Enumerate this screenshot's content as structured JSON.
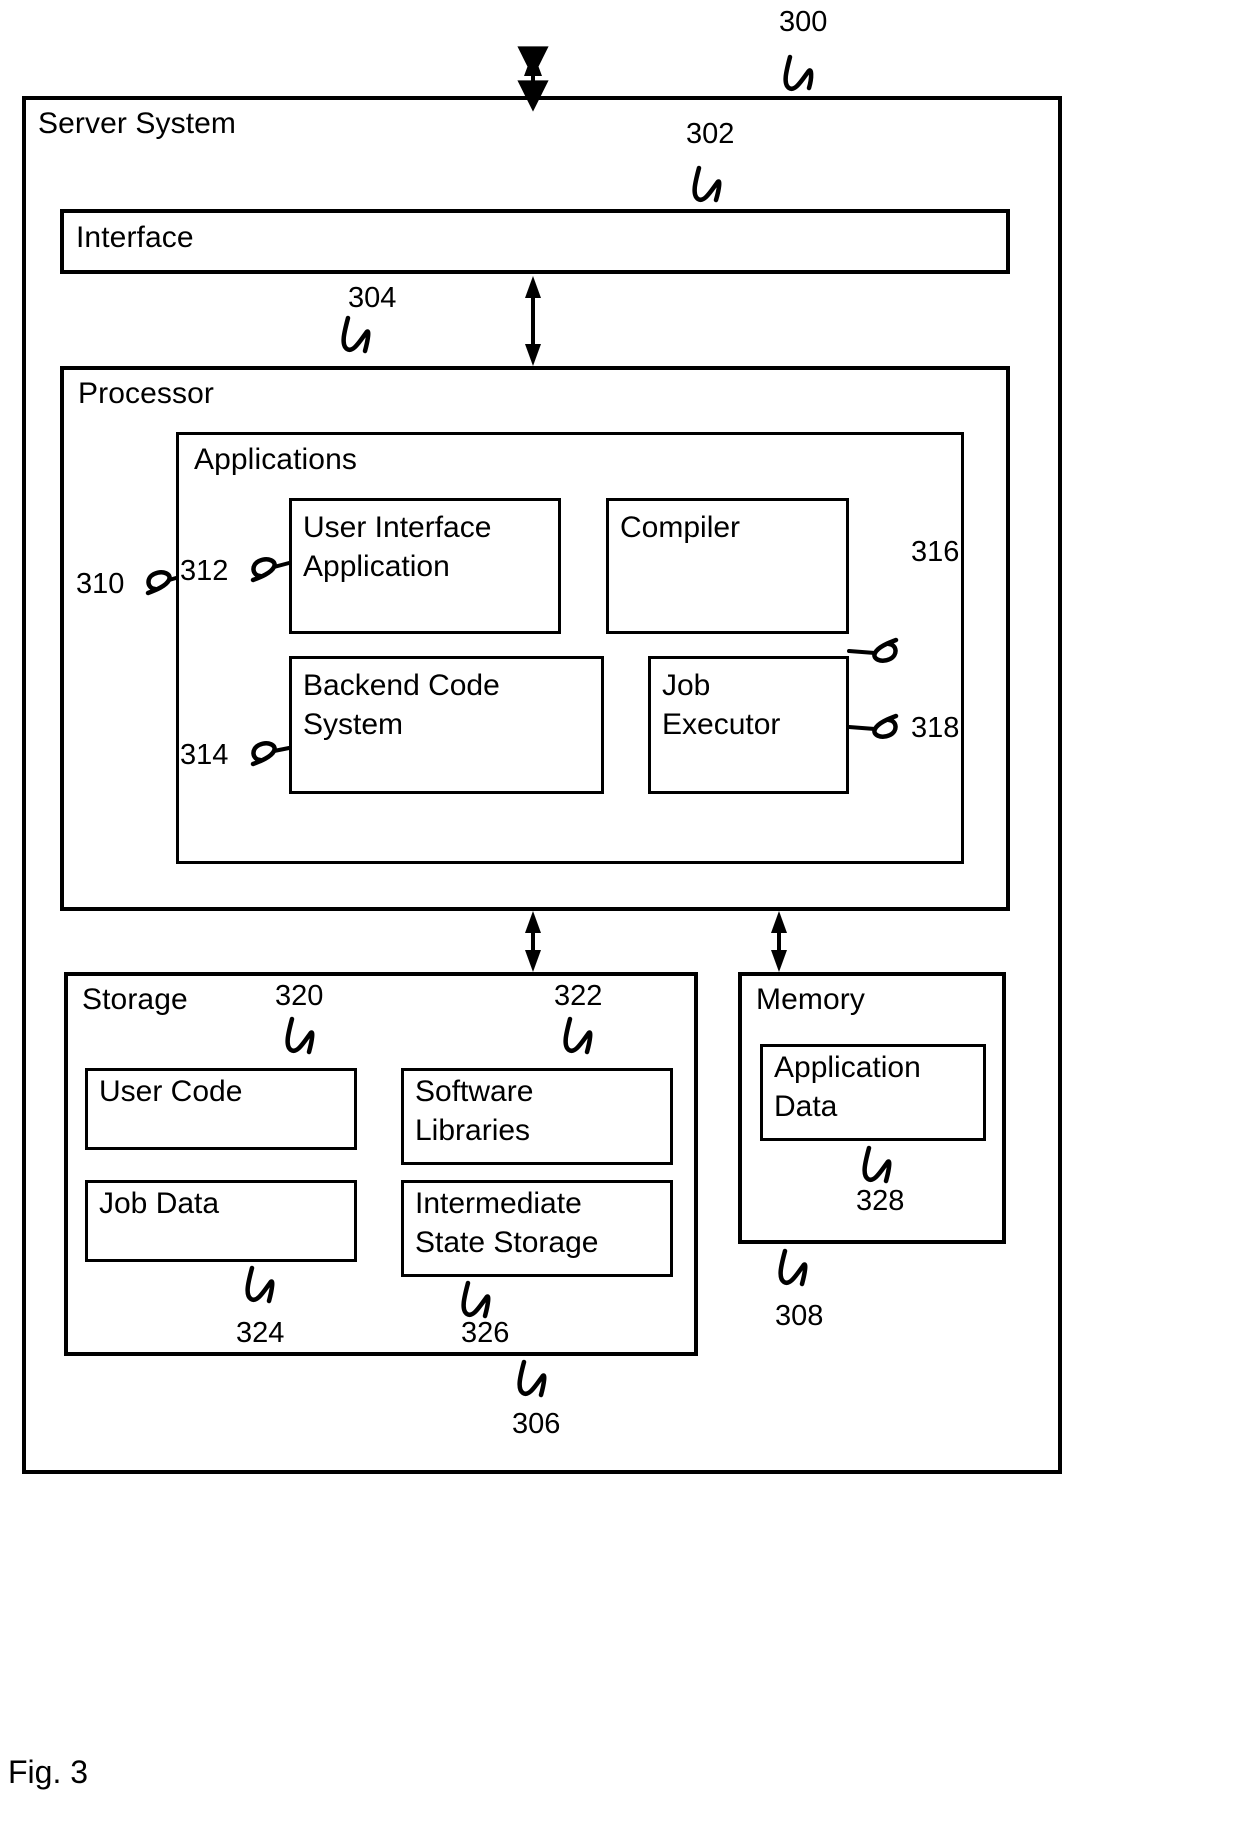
{
  "figure": {
    "caption": "Fig. 3",
    "title_numeral": "300"
  },
  "diagram": {
    "server_system": {
      "label": "Server System",
      "ref": "300"
    },
    "interface": {
      "label": "Interface",
      "ref": "302"
    },
    "processor": {
      "label": "Processor",
      "ref": "304"
    },
    "applications": {
      "label": "Applications",
      "ref": "310",
      "modules": [
        {
          "label": "User Interface\nApplication",
          "ref": "312"
        },
        {
          "label": "Compiler",
          "ref": "316"
        },
        {
          "label": "Backend Code\nSystem",
          "ref": "314"
        },
        {
          "label": "Job\nExecutor",
          "ref": "318"
        }
      ]
    },
    "storage": {
      "label": "Storage",
      "ref": "306",
      "items": [
        {
          "label": "User Code",
          "ref": "320"
        },
        {
          "label": "Software\nLibraries",
          "ref": "322"
        },
        {
          "label": "Job Data",
          "ref": "324"
        },
        {
          "label": "Intermediate\nState Storage",
          "ref": "326"
        }
      ]
    },
    "memory": {
      "label": "Memory",
      "ref": "308",
      "items": [
        {
          "label": "Application\nData",
          "ref": "328"
        }
      ]
    }
  },
  "style": {
    "line_color": "#000000",
    "background": "#ffffff"
  }
}
